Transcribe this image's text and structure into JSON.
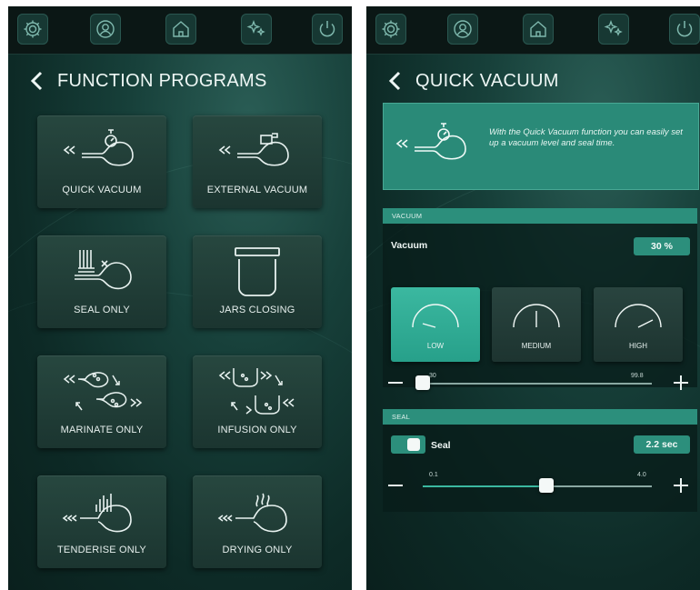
{
  "left": {
    "title": "FUNCTION PROGRAMS",
    "programs": [
      {
        "label": "QUICK VACUUM",
        "icon": "quick-vacuum-icon"
      },
      {
        "label": "EXTERNAL VACUUM",
        "icon": "external-vacuum-icon"
      },
      {
        "label": "SEAL ONLY",
        "icon": "seal-only-icon"
      },
      {
        "label": "JARS CLOSING",
        "icon": "jar-icon"
      },
      {
        "label": "MARINATE ONLY",
        "icon": "marinate-icon"
      },
      {
        "label": "INFUSION ONLY",
        "icon": "infusion-icon"
      },
      {
        "label": "TENDERISE ONLY",
        "icon": "tenderise-icon"
      },
      {
        "label": "DRYING ONLY",
        "icon": "drying-icon"
      }
    ]
  },
  "right": {
    "title": "QUICK VACUUM",
    "info": "With the Quick Vacuum function you can easily set up a vacuum level and seal time.",
    "vacuum": {
      "section_label": "VACUUM",
      "row_label": "Vacuum",
      "value": "30 %",
      "presets": [
        "LOW",
        "MEDIUM",
        "HIGH"
      ],
      "selected_preset": "LOW",
      "min_label": "30",
      "max_label": "99.8",
      "level": 30
    },
    "seal": {
      "section_label": "SEAL",
      "row_label": "Seal",
      "value": "2.2 sec",
      "min_label": "0.1",
      "max_label": "4.0",
      "level": 2.2,
      "toggle_on": true
    }
  },
  "toolbar": [
    "settings-gear-icon",
    "user-profile-icon",
    "home-icon",
    "sparkle-icon",
    "power-icon"
  ],
  "colors": {
    "accent": "#2c8f7c",
    "accent_light": "#3bb8a0",
    "bg": "#0d2a26"
  }
}
